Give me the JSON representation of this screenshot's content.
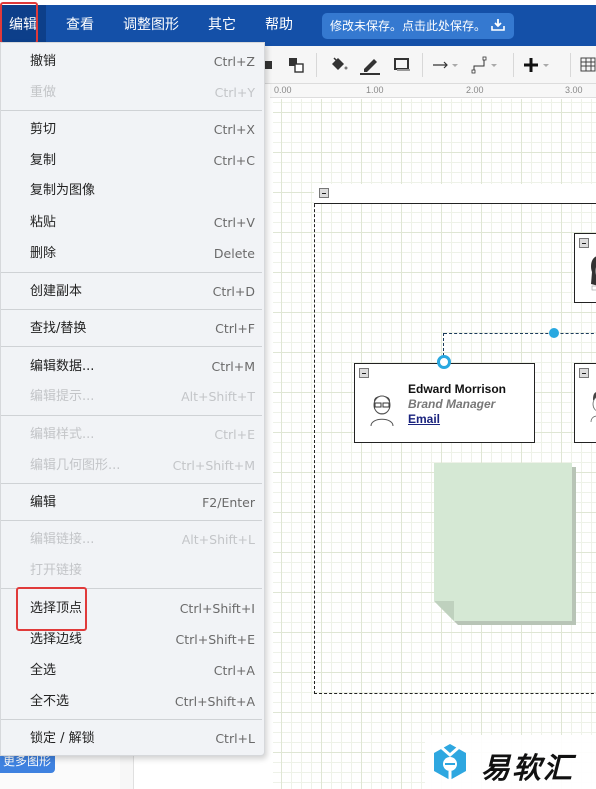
{
  "menubar": {
    "items": [
      {
        "label": "编辑",
        "active": true
      },
      {
        "label": "查看"
      },
      {
        "label": "调整图形"
      },
      {
        "label": "其它"
      },
      {
        "label": "帮助"
      }
    ],
    "save_notice": "修改未保存。点击此处保存。"
  },
  "toolbar": {
    "icons": [
      "to-front-icon",
      "to-back-icon",
      "fill-color-icon",
      "line-color-icon",
      "shadow-icon",
      "connection-arrow-icon",
      "waypoints-icon",
      "insert-plus-icon",
      "table-icon"
    ]
  },
  "ruler": {
    "labels": [
      "0.00",
      "1.00",
      "2.00",
      "3.00"
    ]
  },
  "sidebar": {
    "more_shapes": "更多图形"
  },
  "edit_menu": {
    "items": [
      {
        "label": "撤销",
        "shortcut": "Ctrl+Z",
        "enabled": true
      },
      {
        "label": "重做",
        "shortcut": "Ctrl+Y",
        "enabled": false
      },
      {
        "label": "剪切",
        "shortcut": "Ctrl+X",
        "enabled": true
      },
      {
        "label": "复制",
        "shortcut": "Ctrl+C",
        "enabled": true
      },
      {
        "label": "复制为图像",
        "shortcut": "",
        "enabled": true
      },
      {
        "label": "粘贴",
        "shortcut": "Ctrl+V",
        "enabled": true
      },
      {
        "label": "删除",
        "shortcut": "Delete",
        "enabled": true
      },
      {
        "label": "创建副本",
        "shortcut": "Ctrl+D",
        "enabled": true
      },
      {
        "label": "查找/替换",
        "shortcut": "Ctrl+F",
        "enabled": true
      },
      {
        "label": "编辑数据...",
        "shortcut": "Ctrl+M",
        "enabled": true
      },
      {
        "label": "编辑提示...",
        "shortcut": "Alt+Shift+T",
        "enabled": false
      },
      {
        "label": "编辑样式...",
        "shortcut": "Ctrl+E",
        "enabled": false
      },
      {
        "label": "编辑几何图形...",
        "shortcut": "Ctrl+Shift+M",
        "enabled": false
      },
      {
        "label": "编辑",
        "shortcut": "F2/Enter",
        "enabled": true
      },
      {
        "label": "编辑链接...",
        "shortcut": "Alt+Shift+L",
        "enabled": false
      },
      {
        "label": "打开链接",
        "shortcut": "",
        "enabled": false
      },
      {
        "label": "选择顶点",
        "shortcut": "Ctrl+Shift+I",
        "enabled": true,
        "highlighted": true
      },
      {
        "label": "选择边线",
        "shortcut": "Ctrl+Shift+E",
        "enabled": true
      },
      {
        "label": "全选",
        "shortcut": "Ctrl+A",
        "enabled": true
      },
      {
        "label": "全不选",
        "shortcut": "Ctrl+Shift+A",
        "enabled": true
      },
      {
        "label": "锁定 / 解锁",
        "shortcut": "Ctrl+L",
        "enabled": true
      }
    ]
  },
  "diagram": {
    "card": {
      "name": "Edward Morrison",
      "role": "Brand Manager",
      "link": "Email"
    },
    "note_color": "#d5e8d4"
  },
  "watermark": {
    "text": "易软汇"
  },
  "colors": {
    "menubar": "#1450a8",
    "highlight_border": "#e03a3a",
    "selection_handle": "#29a8e0"
  }
}
